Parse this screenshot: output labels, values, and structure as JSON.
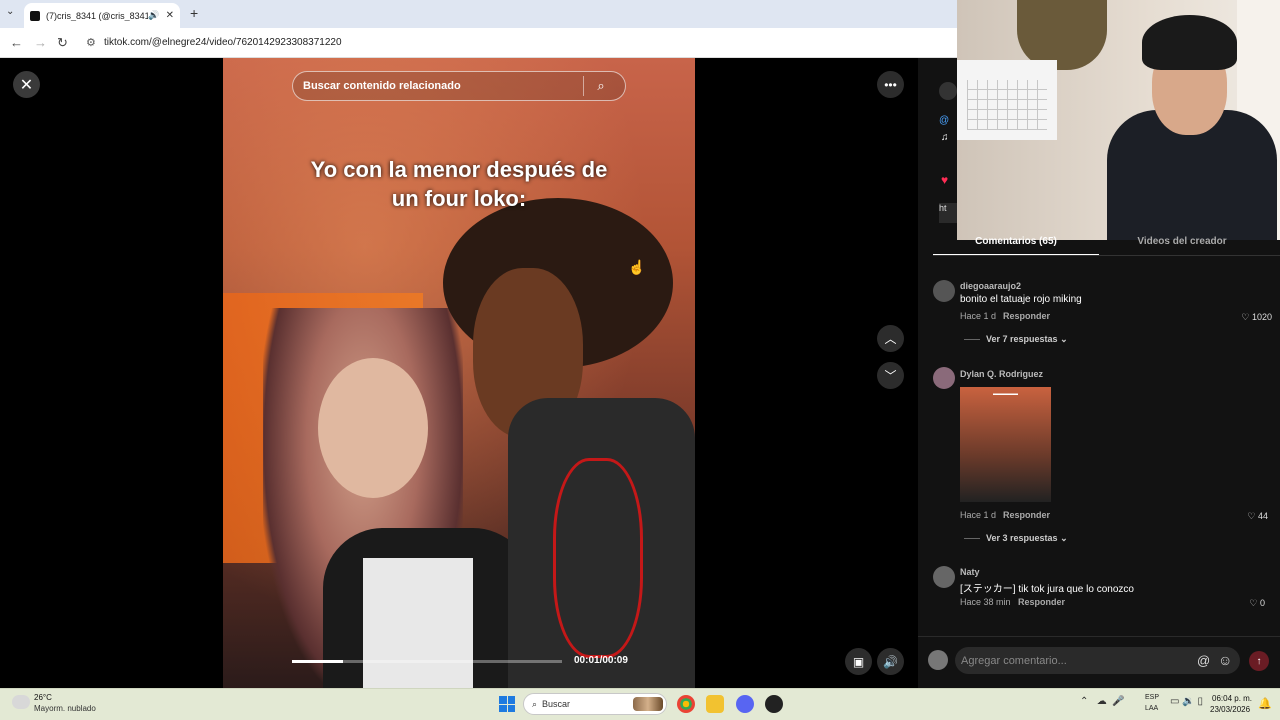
{
  "browser": {
    "tab_title": "(7)cris_8341 (@cris_8341) |",
    "url": "tiktok.com/@elnegre24/video/7620142923308371220"
  },
  "video": {
    "search_placeholder": "Buscar contenido relacionado",
    "caption_line1": "Yo con la menor después de",
    "caption_line2": "un four loko:",
    "time_display": "00:01/00:09",
    "progress": 0.19
  },
  "panel": {
    "tab_comments": "Comentarios (65)",
    "tab_creator": "Videos del creador",
    "comments": [
      {
        "user": "diegoaaraujo2",
        "text": "bonito el tatuaje rojo miking",
        "time": "Hace 1 d",
        "reply": "Responder",
        "likes": "1020",
        "more": "Ver 7 respuestas"
      },
      {
        "user": "Dylan Q. Rodriguez",
        "text": "",
        "time": "Hace 1 d",
        "reply": "Responder",
        "likes": "44",
        "more": "Ver 3 respuestas"
      },
      {
        "user": "Naty",
        "text": "[ステッカー] tik tok jura que lo conozco",
        "time": "Hace 38 min",
        "reply": "Responder",
        "likes": "0"
      }
    ],
    "comment_placeholder": "Agregar comentario..."
  },
  "taskbar": {
    "temp": "26°C",
    "condition": "Mayorm. nublado",
    "search": "Buscar",
    "lang1": "ESP",
    "lang2": "LAA",
    "time": "06:04 p. m.",
    "date": "23/03/2026"
  },
  "colors": {
    "tiktok_red": "#fe2c55",
    "panel_bg": "#121212",
    "taskbar_bg": "#e3e9d4"
  }
}
